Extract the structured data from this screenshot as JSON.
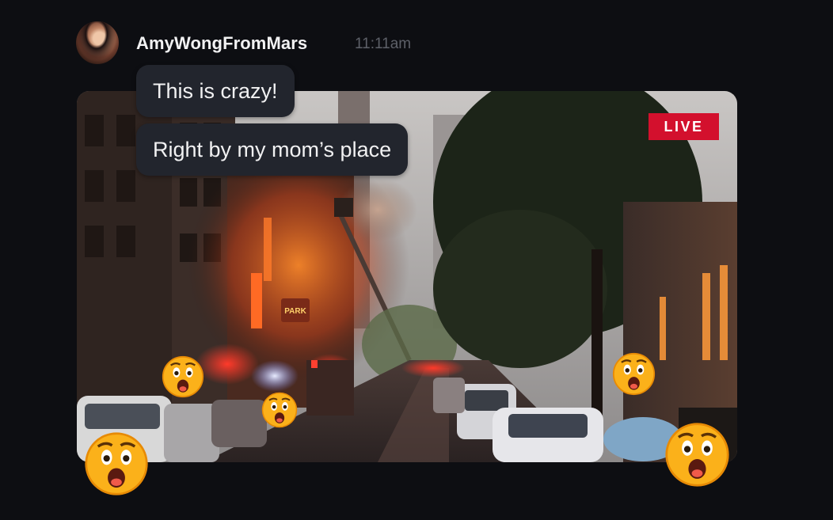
{
  "message": {
    "author": "AmyWongFromMars",
    "time": "11:11am",
    "lines": [
      "This is crazy!",
      "Right by my mom’s place"
    ]
  },
  "media": {
    "badge": "LIVE",
    "badge_color": "#d3102d",
    "sign_text": "PARK"
  },
  "reactions": [
    {
      "icon": "astonished-face-icon"
    },
    {
      "icon": "astonished-face-icon"
    },
    {
      "icon": "astonished-face-icon"
    },
    {
      "icon": "astonished-face-icon"
    },
    {
      "icon": "astonished-face-icon"
    }
  ],
  "colors": {
    "background": "#0d0e12",
    "bubble": "#22252d",
    "username": "#f2f2f3",
    "timestamp": "#5d6068"
  }
}
